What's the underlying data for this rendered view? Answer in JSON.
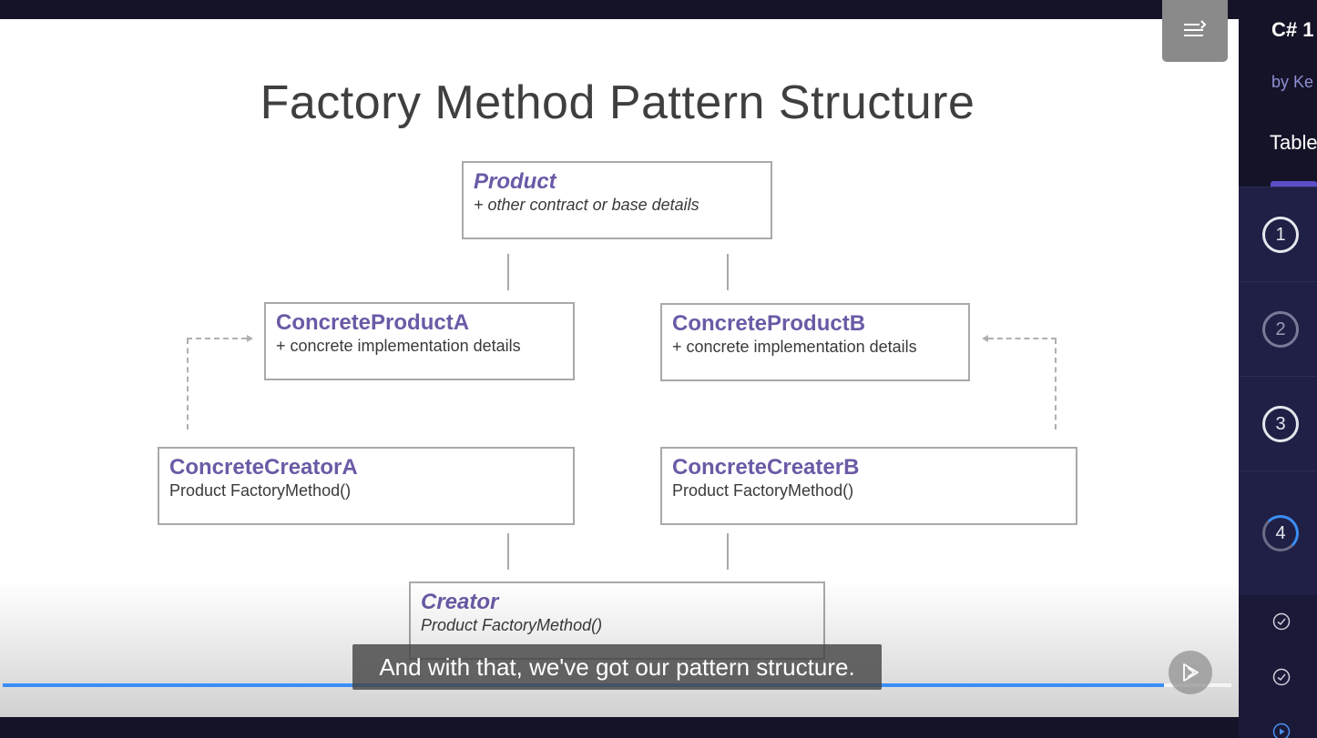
{
  "slide": {
    "title": "Factory Method Pattern Structure",
    "boxes": {
      "product": {
        "name": "Product",
        "detail": "+ other contract or base details"
      },
      "concrete_product_a": {
        "name": "ConcreteProductA",
        "detail": "+ concrete implementation details"
      },
      "concrete_product_b": {
        "name": "ConcreteProductB",
        "detail": "+ concrete implementation details"
      },
      "concrete_creator_a": {
        "name": "ConcreteCreatorA",
        "detail": "Product FactoryMethod()"
      },
      "concrete_creater_b": {
        "name": "ConcreteCreaterB",
        "detail": "Product FactoryMethod()"
      },
      "creator": {
        "name": "Creator",
        "detail": "Product FactoryMethod()"
      }
    }
  },
  "player": {
    "caption": "And with that, we've got our pattern structure.",
    "progress_fraction": 0.945,
    "icons": {
      "menu": "playlist-menu-icon",
      "next": "next-clip-icon"
    }
  },
  "sidebar": {
    "course_title": "C# 1",
    "author": "by Ke",
    "tab_label": "Table",
    "modules": [
      {
        "number": "1"
      },
      {
        "number": "2"
      },
      {
        "number": "3"
      },
      {
        "number": "4"
      }
    ],
    "clips": [
      {
        "icon": "check-circle-icon"
      },
      {
        "icon": "check-circle-icon"
      },
      {
        "icon": "play-circle-icon"
      }
    ]
  },
  "colors": {
    "accent_purple": "#6b5aa6",
    "progress_blue": "#3a8ef5",
    "sidebar_bg": "#1a1a38"
  }
}
